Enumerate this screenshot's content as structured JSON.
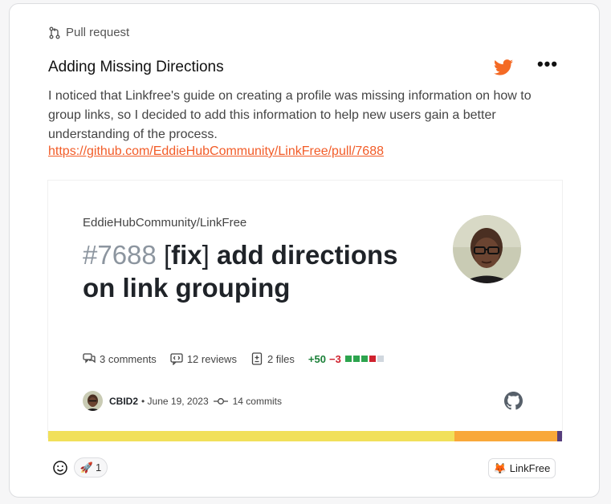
{
  "post": {
    "type_label": "Pull request",
    "title": "Adding Missing Directions",
    "description": "I noticed that Linkfree's guide on creating a profile was missing information on how to group links, so I decided to add this information to help new users gain a better understanding of the process.",
    "link": "https://github.com/EddieHubCommunity/LinkFree/pull/7688",
    "more_label": "•••"
  },
  "preview": {
    "repo": "EddieHubCommunity/LinkFree",
    "pr_number": "#7688",
    "title_open": "[",
    "title_tag": "fix",
    "title_close": "]",
    "title_rest": " add directions on link grouping",
    "comments": "3 comments",
    "reviews": "12 reviews",
    "files": "2 files",
    "additions": "+50",
    "deletions": "−3",
    "diff_boxes": [
      "#2da44e",
      "#2da44e",
      "#2da44e",
      "#cf222e",
      "#d0d7de"
    ],
    "author": "CBID2",
    "date": "• June 19, 2023",
    "commits": "14 commits",
    "language_colors": [
      "#f1e05a",
      "#f9a83a",
      "#563d7c"
    ],
    "language_shares": [
      0.79,
      0.2,
      0.01
    ]
  },
  "footer": {
    "reaction_emoji": "🚀",
    "reaction_count": "1",
    "tag_emoji": "🦊",
    "tag_label": "LinkFree"
  },
  "colors": {
    "accent": "#f25c28",
    "twitter_bird": "#f46a25"
  }
}
